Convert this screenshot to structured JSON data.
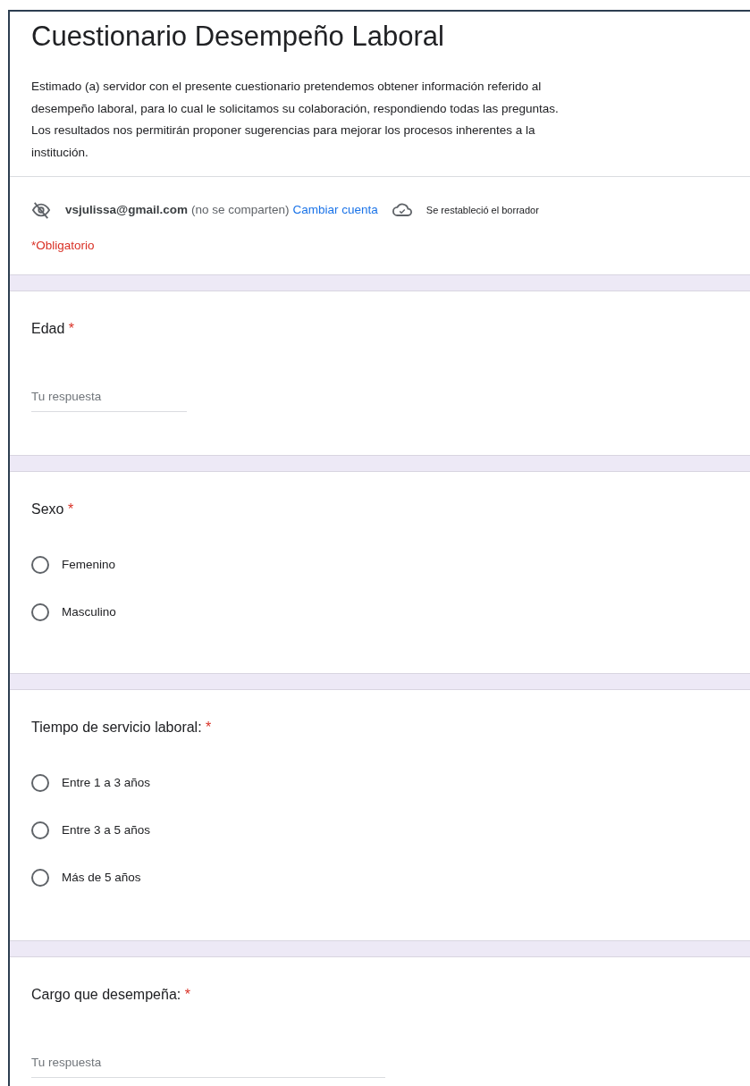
{
  "form": {
    "title": "Cuestionario Desempeño Laboral",
    "description": "Estimado (a) servidor con el presente cuestionario pretendemos obtener información referido al desempeño laboral, para lo cual le solicitamos su colaboración, respondiendo todas las preguntas. Los resultados nos permitirán proponer sugerencias para mejorar los procesos inherentes a la institución.",
    "account": {
      "email": "vsjulissa@gmail.com",
      "note": "(no se comparten)",
      "switch_link": "Cambiar cuenta",
      "draft_status": "Se restableció el borrador"
    },
    "required_note": "*Obligatorio"
  },
  "questions": [
    {
      "kind": "text",
      "label": "Edad",
      "required_mark": "*",
      "placeholder": "Tu respuesta"
    },
    {
      "kind": "radio",
      "label": "Sexo",
      "required_mark": "*",
      "options": [
        {
          "label": "Femenino",
          "selected": false
        },
        {
          "label": "Masculino",
          "selected": false
        }
      ]
    },
    {
      "kind": "radio",
      "label": "Tiempo de servicio laboral:",
      "required_mark": "*",
      "options": [
        {
          "label": "Entre 1 a 3 años",
          "selected": false
        },
        {
          "label": "Entre 3 a 5 años",
          "selected": false
        },
        {
          "label": "Más de 5 años",
          "selected": false
        }
      ]
    },
    {
      "kind": "text",
      "label": "Cargo que desempeña:",
      "required_mark": "*",
      "placeholder": "Tu respuesta",
      "wide": true
    }
  ]
}
